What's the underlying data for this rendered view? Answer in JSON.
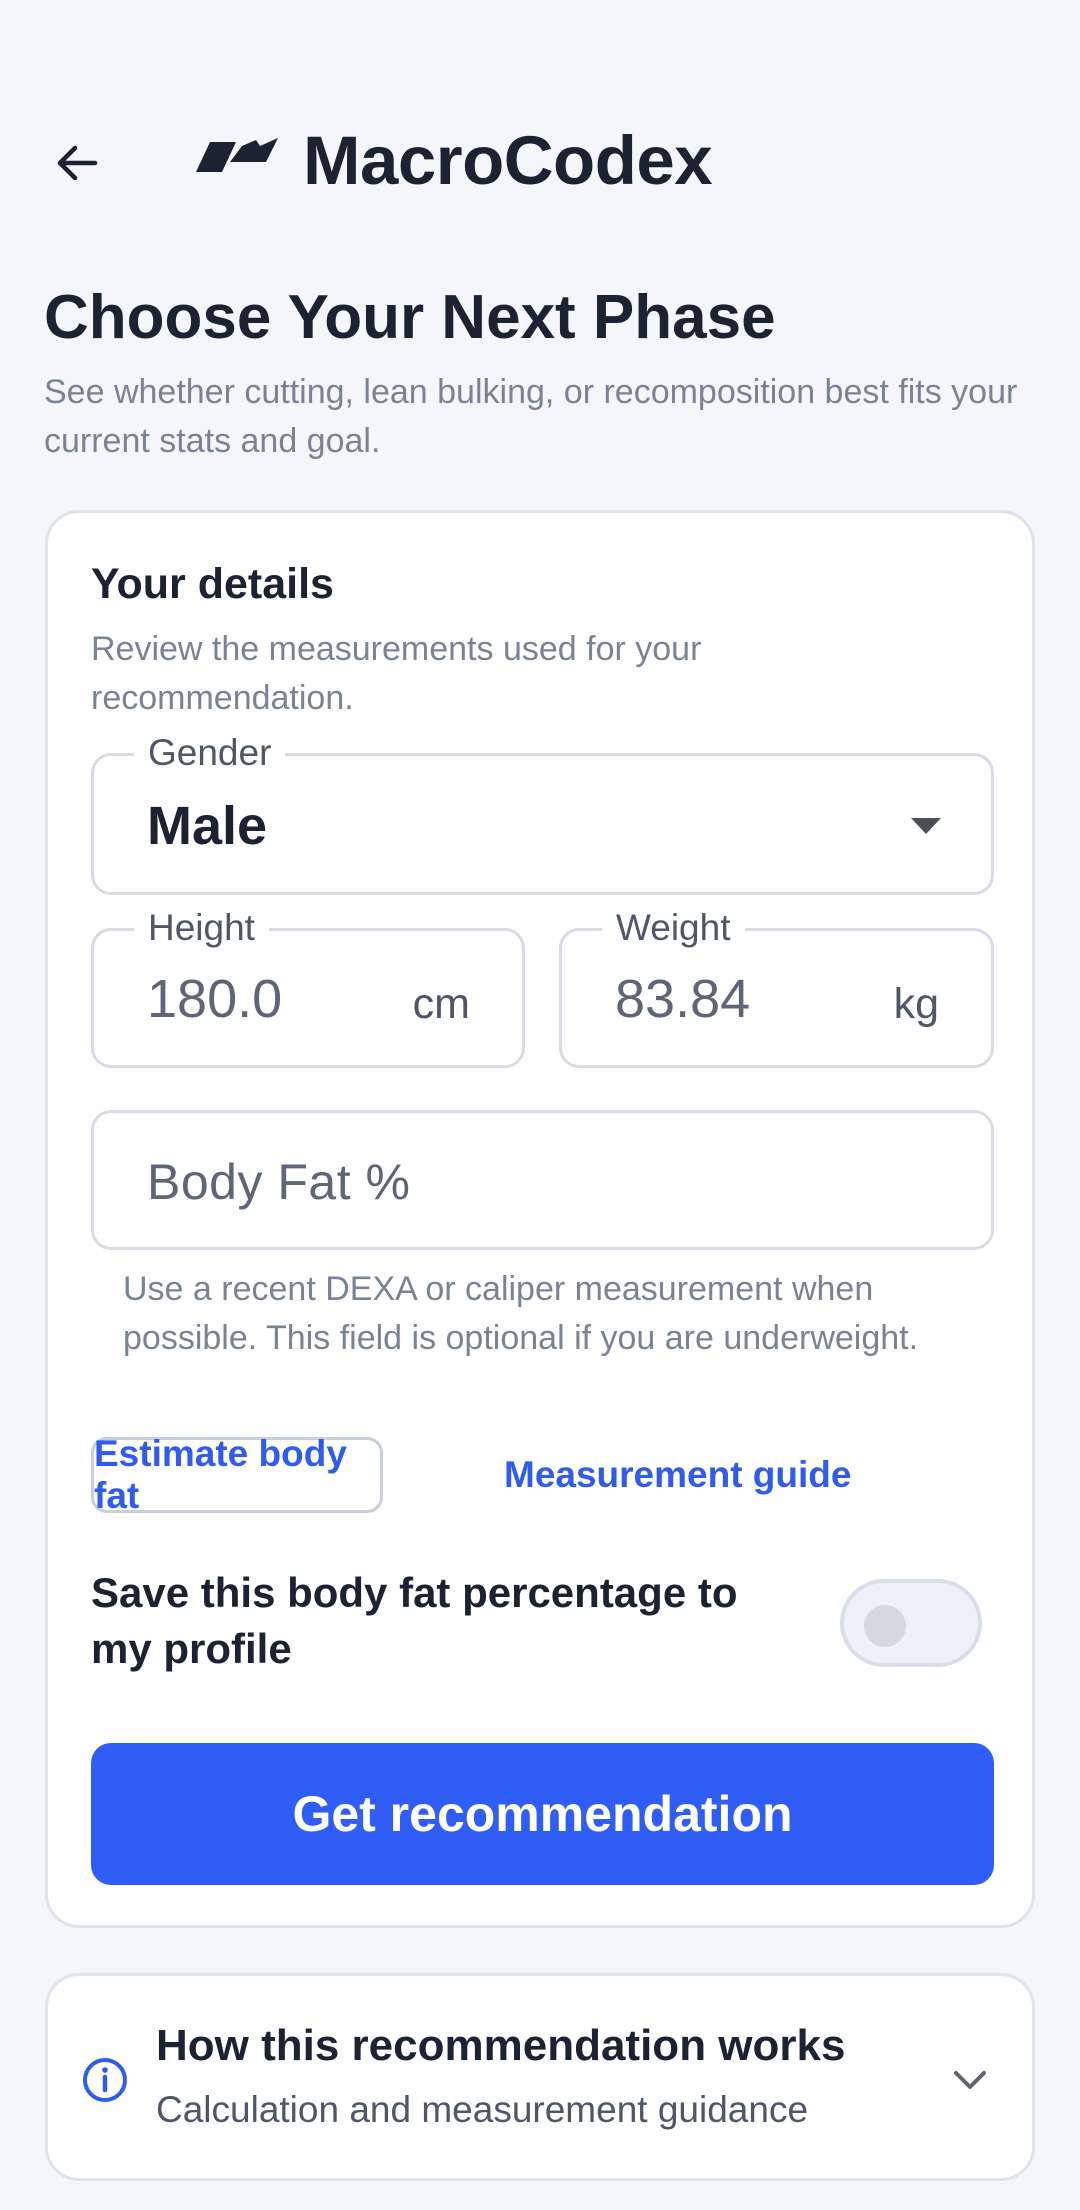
{
  "app": {
    "title": "MacroCodex"
  },
  "page": {
    "title": "Choose Your Next Phase",
    "subtitle": "See whether cutting, lean bulking, or recomposition best fits your current stats and goal."
  },
  "details_card": {
    "title": "Your details",
    "description": "Review the measurements used for your recommendation.",
    "gender": {
      "label": "Gender",
      "value": "Male"
    },
    "height": {
      "label": "Height",
      "value": "180.0",
      "unit": "cm"
    },
    "weight": {
      "label": "Weight",
      "value": "83.84",
      "unit": "kg"
    },
    "body_fat": {
      "placeholder": "Body Fat %",
      "value": ""
    },
    "helper_text": "Use a recent DEXA or caliper measurement when possible. This field is optional if you are underweight.",
    "estimate_button": "Estimate body fat",
    "guide_link": "Measurement guide",
    "save_toggle": {
      "label": "Save this body fat percentage to my profile",
      "on": false
    },
    "cta_label": "Get recommendation"
  },
  "info_card": {
    "title": "How this recommendation works",
    "subtitle": "Calculation and measurement guidance"
  },
  "colors": {
    "accent": "#2f5df5",
    "link": "#2f5bf0",
    "text": "#1b2333",
    "muted": "#7a8396",
    "background": "#f4f6fa"
  },
  "icons": [
    "arrow-left-icon",
    "logo-icon",
    "caret-down-icon",
    "info-icon",
    "chevron-down-icon"
  ]
}
